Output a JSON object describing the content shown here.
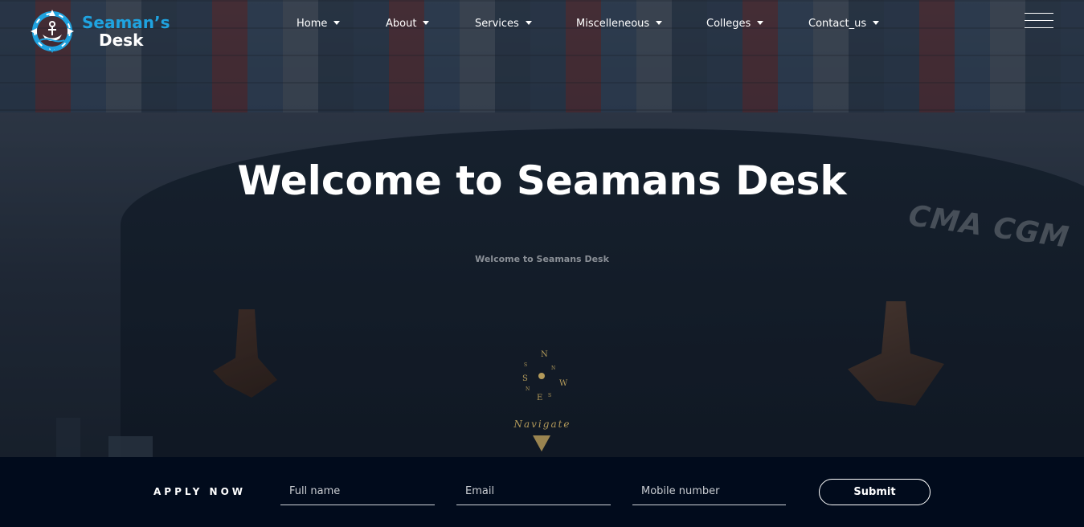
{
  "brand": {
    "name_line1": "Seaman’s",
    "name_line2": "Desk",
    "primary_color": "#1fa3e0"
  },
  "nav": {
    "items": [
      {
        "label": "Home"
      },
      {
        "label": "About"
      },
      {
        "label": "Services"
      },
      {
        "label": "Miscelleneous"
      },
      {
        "label": "Colleges"
      },
      {
        "label": "Contact_us"
      }
    ],
    "menu_icon": "hamburger-menu-icon"
  },
  "hero": {
    "title": "Welcome to Seamans Desk",
    "subtitle": "Welcome to Seamans Desk",
    "ship_text": "CMA CGM",
    "compass": {
      "n": "N",
      "s": "S",
      "e": "E",
      "w": "W"
    },
    "navigate_label": "Navigate",
    "accent_color": "#b39a5a"
  },
  "apply": {
    "label": "APPLY NOW",
    "fullname_placeholder": "Full name",
    "email_placeholder": "Email",
    "mobile_placeholder": "Mobile number",
    "submit_label": "Submit"
  }
}
